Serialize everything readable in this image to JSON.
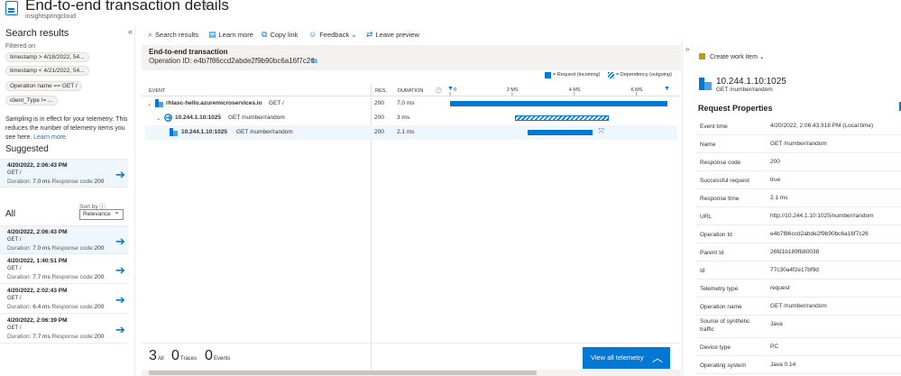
{
  "header": {
    "title": "End-to-end transaction details",
    "subtitle": "insightspringcloud"
  },
  "left": {
    "title": "Search results",
    "filtered_on": "Filtered on",
    "filters": [
      "timestamp > 4/18/2022, 54...",
      "timestamp < 4/21/2022, 54...",
      "Operation name == GET /",
      "client_Type != ..."
    ],
    "sampling_text": "Sampling is in effect for your telemetry. This reduces the number of telemetry items you see here.",
    "learn_more": "Learn more.",
    "suggested_title": "Suggested",
    "all_title": "All",
    "sort_label": "Sort by",
    "sort_value": "Relevance",
    "suggested": [
      {
        "date": "4/20/2022, 2:06:43 PM",
        "method": "GET  /",
        "duration_label": "Duration:",
        "duration": "7.0 ms",
        "code_label": "Response code:",
        "code": "200"
      }
    ],
    "results": [
      {
        "date": "4/20/2022, 2:06:43 PM",
        "method": "GET  /",
        "duration_label": "Duration:",
        "duration": "7.0 ms",
        "code_label": "Response code:",
        "code": "200"
      },
      {
        "date": "4/20/2022, 1:40:51 PM",
        "method": "GET  /",
        "duration_label": "Duration:",
        "duration": "7.7 ms",
        "code_label": "Response code:",
        "code": "200"
      },
      {
        "date": "4/20/2022, 2:02:43 PM",
        "method": "GET  /",
        "duration_label": "Duration:",
        "duration": "6.4 ms",
        "code_label": "Response code:",
        "code": "200"
      },
      {
        "date": "4/20/2022, 2:06:39 PM",
        "method": "GET  /",
        "duration_label": "Duration:",
        "duration": "7.7 ms",
        "code_label": "Response code:",
        "code": "200"
      }
    ]
  },
  "toolbar": {
    "search_results": "Search results",
    "learn_more": "Learn more",
    "copy_link": "Copy link",
    "feedback": "Feedback",
    "leave_preview": "Leave preview"
  },
  "transaction": {
    "title": "End-to-end transaction",
    "operation_id": "Operation ID: e4b7f86ccd2abde2f9b90bc6a16f7c26",
    "legend_request": "= Request (incoming)",
    "legend_dependency": "= Dependency (outgoing)",
    "col_event": "EVENT",
    "col_res": "RES.",
    "col_duration": "DURATION",
    "ticks": [
      "0",
      "2 MS",
      "4 MS",
      "6 MS"
    ],
    "rows": [
      {
        "name": "rhlasc-hello.azuremicroservices.io",
        "method": "GET /",
        "res": "200",
        "duration": "7.0 ms",
        "start_ms": 0.0,
        "duration_ms": 7.0,
        "kind": "request"
      },
      {
        "name": "10.244.1.10:1025",
        "method": "GET /number/random",
        "res": "200",
        "duration": "3 ms",
        "start_ms": 2.1,
        "duration_ms": 3.0,
        "kind": "dependency"
      },
      {
        "name": "10.244.1.10:1025",
        "method": "GET /number/random",
        "res": "200",
        "duration": "2.1 ms",
        "start_ms": 2.5,
        "duration_ms": 2.1,
        "kind": "request"
      }
    ],
    "axis_max_ms": 7.0,
    "footer": {
      "all_count": "3",
      "all_label": "All",
      "traces_count": "0",
      "traces_label": "Traces",
      "events_count": "0",
      "events_label": "Events",
      "view_all": "View all telemetry"
    }
  },
  "details": {
    "create_work_item": "Create work item",
    "resource_title": "10.244.1.10:1025",
    "resource_sub": "GET /number/random",
    "section_title": "Request Properties",
    "properties": [
      {
        "key": "Event time",
        "value": "4/20/2022, 2:06:43.918 PM (Local time)"
      },
      {
        "key": "Name",
        "value": "GET /number/random"
      },
      {
        "key": "Response code",
        "value": "200"
      },
      {
        "key": "Successful request",
        "value": "true"
      },
      {
        "key": "Response time",
        "value": "2.1 ms"
      },
      {
        "key": "URL",
        "value": "http://10.244.1.10:1025/number/random"
      },
      {
        "key": "Operation Id",
        "value": "e4b7f86ccd2abde2f9b90bc6a16f7c26"
      },
      {
        "key": "Parent Id",
        "value": "26fd1b189fb80038"
      },
      {
        "key": "Id",
        "value": "77c30a4f2e17bf9d"
      },
      {
        "key": "Telemetry type",
        "value": "request"
      },
      {
        "key": "Operation name",
        "value": "GET /number/random"
      },
      {
        "key": "Source of synthetic traffic",
        "value": "Java"
      },
      {
        "key": "Device type",
        "value": "PC"
      },
      {
        "key": "Operating system",
        "value": "Java 0.14"
      }
    ]
  },
  "colors": {
    "accent": "#0078d4",
    "request_bar": "#0078d4",
    "dependency_bar": "#0078d4",
    "selected_row": "#eff6fc"
  }
}
